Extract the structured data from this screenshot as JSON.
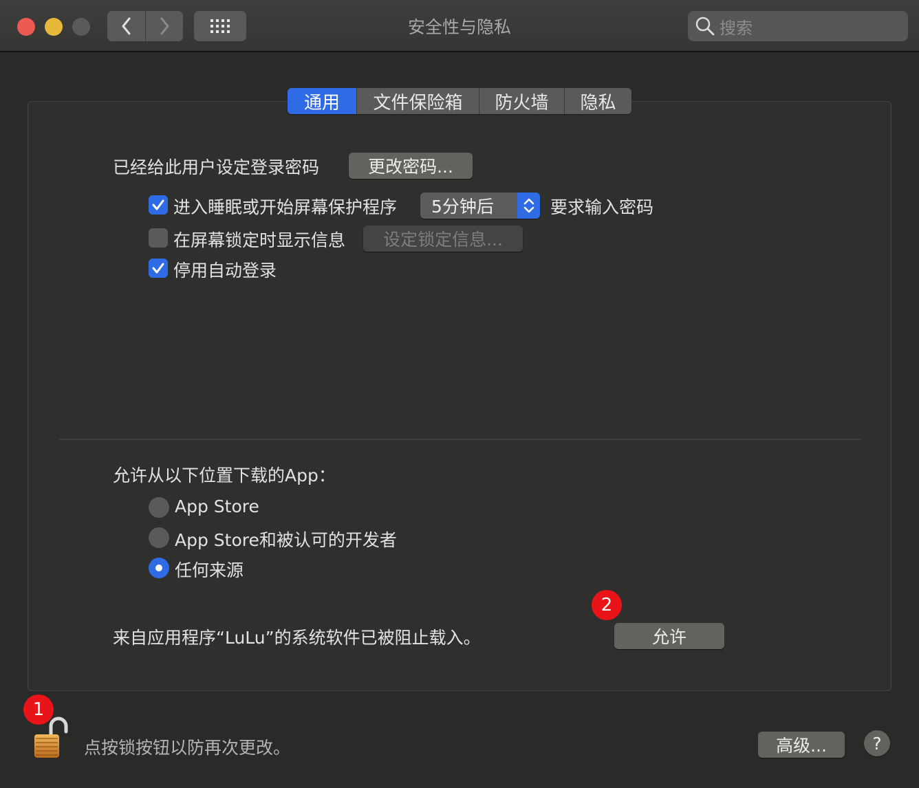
{
  "window": {
    "title": "安全性与隐私"
  },
  "search": {
    "placeholder": "搜索"
  },
  "tabs": [
    {
      "label": "通用",
      "active": true
    },
    {
      "label": "文件保险箱",
      "active": false
    },
    {
      "label": "防火墙",
      "active": false
    },
    {
      "label": "隐私",
      "active": false
    }
  ],
  "general": {
    "password_label": "已经给此用户设定登录密码",
    "change_password_button": "更改密码...",
    "require_password": {
      "label": "进入睡眠或开始屏幕保护程序",
      "checked": true,
      "delay_value": "5分钟后",
      "suffix": "要求输入密码"
    },
    "lock_message": {
      "label": "在屏幕锁定时显示信息",
      "checked": false,
      "button": "设定锁定信息..."
    },
    "disable_autologin": {
      "label": "停用自动登录",
      "checked": true
    }
  },
  "downloads": {
    "heading": "允许从以下位置下载的App：",
    "options": [
      {
        "label": "App Store",
        "selected": false
      },
      {
        "label": "App Store和被认可的开发者",
        "selected": false
      },
      {
        "label": "任何来源",
        "selected": true
      }
    ]
  },
  "blocked": {
    "message": "来自应用程序“LuLu”的系统软件已被阻止载入。",
    "allow_button": "允许"
  },
  "footer": {
    "lock_text": "点按锁按钮以防再次更改。",
    "advanced_button": "高级...",
    "help_label": "?"
  },
  "badges": {
    "lock_badge": "1",
    "allow_badge": "2"
  },
  "colors": {
    "accent": "#2f6be5",
    "badge": "#e8141a",
    "close": "#ee5a52",
    "minimize": "#e6b93a"
  }
}
